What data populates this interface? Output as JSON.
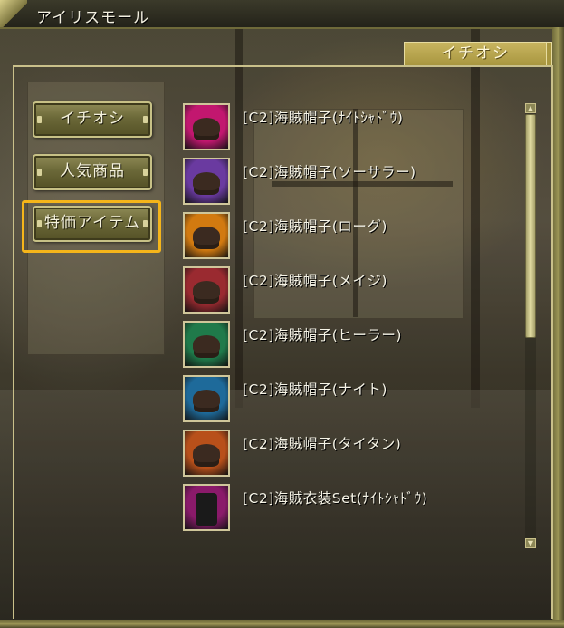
{
  "window": {
    "title": "アイリスモール"
  },
  "tabs": [
    {
      "label": "イチオシ",
      "active": true
    }
  ],
  "nav": {
    "buttons": [
      {
        "label": "イチオシ"
      },
      {
        "label": "人気商品"
      },
      {
        "label": "特価アイテム",
        "highlighted": true
      }
    ]
  },
  "items": [
    {
      "name": "[C2]海賊帽子(ﾅｲﾄｼｬﾄﾞｳ)",
      "icon": "pirate-hat-icon",
      "bg": "#c2176f"
    },
    {
      "name": "[C2]海賊帽子(ソーサラー)",
      "icon": "pirate-hat-icon",
      "bg": "#6a3aa0"
    },
    {
      "name": "[C2]海賊帽子(ローグ)",
      "icon": "pirate-hat-icon",
      "bg": "#d27a10"
    },
    {
      "name": "[C2]海賊帽子(メイジ)",
      "icon": "pirate-hat-icon",
      "bg": "#9a2a30"
    },
    {
      "name": "[C2]海賊帽子(ヒーラー)",
      "icon": "pirate-hat-icon",
      "bg": "#1f7a4a"
    },
    {
      "name": "[C2]海賊帽子(ナイト)",
      "icon": "pirate-hat-icon",
      "bg": "#1e6a9a"
    },
    {
      "name": "[C2]海賊帽子(タイタン)",
      "icon": "pirate-hat-icon",
      "bg": "#b8501a"
    },
    {
      "name": "[C2]海賊衣装Set(ﾅｲﾄｼｬﾄﾞｳ)",
      "icon": "pirate-costume-icon",
      "bg": "#8a1a6a"
    }
  ],
  "colors": {
    "highlight": "#f5b51a",
    "frame": "#c9c08a",
    "tab": "#b8a54e"
  }
}
